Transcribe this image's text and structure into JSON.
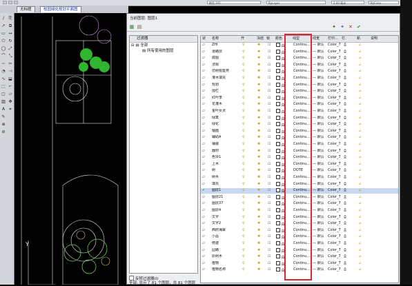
{
  "toolbar": {
    "color_value": "颜色 101",
    "linetype_value": "ByLayer",
    "lineweight_value": "2.00 毫米",
    "extra_value": "ByColor"
  },
  "tabs": [
    "无标题",
    "校园绿化规划平面图"
  ],
  "layer_manager": {
    "title": "当前图层: 图层1",
    "filter_header": "过滤器",
    "tree_all": "全部",
    "tree_used": "所有使用的图层",
    "invert_filter": "反转过滤器(I)",
    "status": "全部: 显示了 81 个图层，共 81 个图层",
    "columns": [
      "状",
      "名称",
      "开",
      "冻结",
      "锁",
      "颜色",
      "线型",
      "线宽",
      "打印…",
      "打.",
      "新.",
      "说明"
    ],
    "rows": [
      {
        "name": "ZHI",
        "color": "白",
        "linetype": "Continu…",
        "lineweight": "— 默认",
        "plot": "Color_7",
        "current": false
      },
      {
        "name": "道路层",
        "color": "白",
        "linetype": "Continu…",
        "lineweight": "— 默认",
        "plot": "Color_7",
        "current": false
      },
      {
        "name": "底图",
        "color": "白",
        "linetype": "Continu…",
        "lineweight": "— 默认",
        "plot": "Color_7",
        "current": false
      },
      {
        "name": "法桐",
        "color": "白",
        "linetype": "Continu…",
        "lineweight": "— 默认",
        "plot": "Color_7",
        "current": false
      },
      {
        "name": "仿树桩座凳",
        "color": "白",
        "linetype": "Continu…",
        "lineweight": "— 默认",
        "plot": "Color_7",
        "current": false
      },
      {
        "name": "灌木填充",
        "color": "白",
        "linetype": "Continu…",
        "lineweight": "— 默认",
        "plot": "Color_7",
        "current": false
      },
      {
        "name": "规划",
        "color": "白",
        "linetype": "Continu…",
        "lineweight": "— 默认",
        "plot": "Color_7",
        "current": false
      },
      {
        "name": "围栏",
        "color": "白",
        "linetype": "Continu…",
        "lineweight": "— 默认",
        "plot": "Color_7",
        "current": false
      },
      {
        "name": "红叶李",
        "color": "白",
        "linetype": "Continu…",
        "lineweight": "— 默认",
        "plot": "Color_7",
        "current": false
      },
      {
        "name": "花灌木",
        "color": "白",
        "linetype": "Continu…",
        "lineweight": "— 默认",
        "plot": "Color_7",
        "current": false
      },
      {
        "name": "金叶女贞",
        "color": "白",
        "linetype": "Continu…",
        "lineweight": "— 默认",
        "plot": "Color_7",
        "current": false
      },
      {
        "name": "绿篱",
        "color": "白",
        "linetype": "Continu…",
        "lineweight": "— 默认",
        "plot": "Color_7",
        "current": false
      },
      {
        "name": "绿化",
        "color": "白",
        "linetype": "Continu…",
        "lineweight": "— 默认",
        "plot": "Color_7",
        "current": false
      },
      {
        "name": "轴面",
        "color": "白",
        "linetype": "Continu…",
        "lineweight": "— 默认",
        "plot": "Color_7",
        "current": false
      },
      {
        "name": "辅助A",
        "color": "白",
        "linetype": "Continu…",
        "lineweight": "— 默认",
        "plot": "Color_7",
        "current": false
      },
      {
        "name": "铺装",
        "color": "白",
        "linetype": "Continu…",
        "lineweight": "— 默认",
        "plot": "Color_7",
        "current": false
      },
      {
        "name": "器材",
        "color": "白",
        "linetype": "Continu…",
        "lineweight": "— 默认",
        "plot": "Color_7",
        "current": false
      },
      {
        "name": "色块1",
        "color": "白",
        "linetype": "Continu…",
        "lineweight": "— 默认",
        "plot": "Color_7",
        "current": false
      },
      {
        "name": "上木",
        "color": "白",
        "linetype": "Continu…",
        "lineweight": "— 默认",
        "plot": "Color_7",
        "current": false
      },
      {
        "name": "树",
        "color": "白",
        "linetype": "DOTE",
        "lineweight": "— 默认",
        "plot": "Color_7",
        "current": false
      },
      {
        "name": "树木",
        "color": "白",
        "linetype": "Continu…",
        "lineweight": "— 默认",
        "plot": "Color_7",
        "current": false
      },
      {
        "name": "填充",
        "color": "白",
        "linetype": "Continu…",
        "lineweight": "— 默认",
        "plot": "Color_7",
        "current": false
      },
      {
        "name": "图层1",
        "color": "白",
        "linetype": "Continu…",
        "lineweight": "— 默认",
        "plot": "Color_7",
        "current": true
      },
      {
        "name": "图层21",
        "color": "白",
        "linetype": "Continu…",
        "lineweight": "— 默认",
        "plot": "Color_7",
        "current": false
      },
      {
        "name": "图层37",
        "color": "白",
        "linetype": "Continu…",
        "lineweight": "— 默认",
        "plot": "Color_7",
        "current": false
      },
      {
        "name": "图层4",
        "color": "白",
        "linetype": "Continu…",
        "lineweight": "— 默认",
        "plot": "Color_7",
        "current": false
      },
      {
        "name": "文字",
        "color": "白",
        "linetype": "Continu…",
        "lineweight": "— 默认",
        "plot": "Color_7",
        "current": false
      },
      {
        "name": "文字2",
        "color": "白",
        "linetype": "Continu…",
        "lineweight": "— 默认",
        "plot": "Color_7",
        "current": false
      },
      {
        "name": "西府海棠",
        "color": "白",
        "linetype": "Continu…",
        "lineweight": "— 默认",
        "plot": "Color_7",
        "current": false
      },
      {
        "name": "小品",
        "color": "白",
        "linetype": "Continu…",
        "lineweight": "— 默认",
        "plot": "Color_7",
        "current": false
      },
      {
        "name": "修建",
        "color": "白",
        "linetype": "Continu…",
        "lineweight": "— 默认",
        "plot": "Color_7",
        "current": false
      },
      {
        "name": "园路",
        "color": "白",
        "linetype": "Continu…",
        "lineweight": "— 默认",
        "plot": "Color_7",
        "current": false
      },
      {
        "name": "原树木",
        "color": "白",
        "linetype": "Continu…",
        "lineweight": "— 默认",
        "plot": "Color_7",
        "current": false
      },
      {
        "name": "植物",
        "color": "白",
        "linetype": "Continu…",
        "lineweight": "— 默认",
        "plot": "Color_7",
        "current": false
      },
      {
        "name": "植物名称",
        "color": "白",
        "linetype": "Continu…",
        "lineweight": "— 默认",
        "plot": "Color_7",
        "current": false
      }
    ]
  },
  "drawing": {
    "axis_label": "Y"
  },
  "colors": {
    "highlight_box": "#e0262a",
    "selected_row": "#c9d8f1",
    "tree_green": "#2fb52f"
  }
}
